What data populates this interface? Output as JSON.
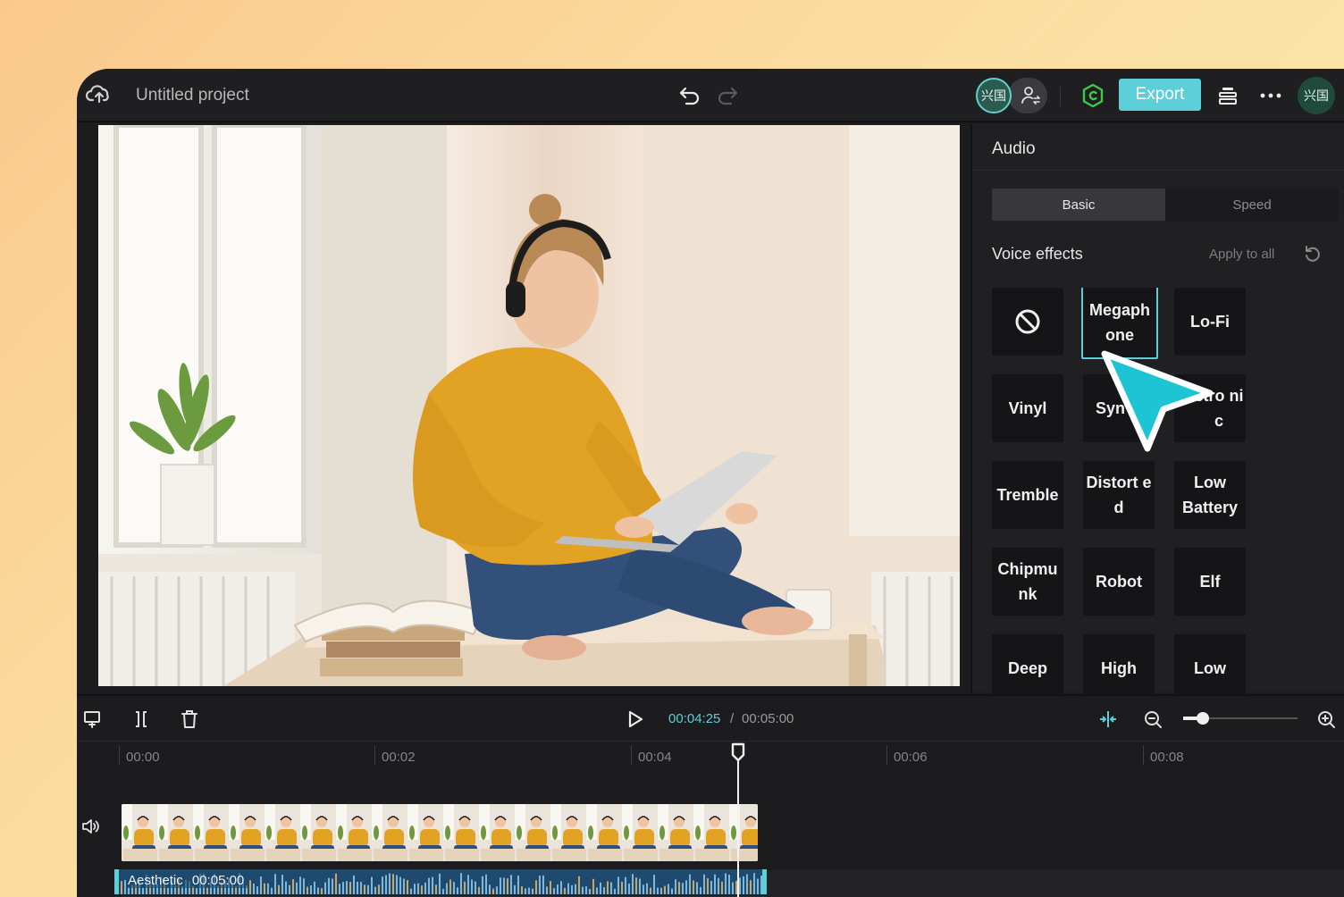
{
  "header": {
    "project_title": "Untitled project",
    "collaborator_initials": "兴国",
    "export_label": "Export",
    "user_initials": "兴国"
  },
  "panel": {
    "title": "Audio",
    "tabs": [
      {
        "label": "Basic",
        "active": true
      },
      {
        "label": "Speed",
        "active": false
      }
    ],
    "section_title": "Voice effects",
    "apply_all_label": "Apply to all",
    "effects": [
      {
        "label": "",
        "icon": "none-icon"
      },
      {
        "label": "Megaph one",
        "selected": true
      },
      {
        "label": "Lo-Fi"
      },
      {
        "label": "Vinyl"
      },
      {
        "label": "Syn"
      },
      {
        "label": "ctro nic"
      },
      {
        "label": "Tremble"
      },
      {
        "label": "Distort ed"
      },
      {
        "label": "Low Battery"
      },
      {
        "label": "Chipmu nk"
      },
      {
        "label": "Robot"
      },
      {
        "label": "Elf"
      },
      {
        "label": "Deep"
      },
      {
        "label": "High"
      },
      {
        "label": "Low"
      }
    ]
  },
  "timeline": {
    "current_time": "00:04:25",
    "separator": "/",
    "total_time": "00:05:00",
    "zoom_level": 0.15,
    "ruler": [
      "00:00",
      "00:02",
      "00:04",
      "00:06",
      "00:08"
    ],
    "audio_clip_name": "Aesthetic",
    "audio_clip_duration": "00:05:00"
  },
  "colors": {
    "accent": "#5ccfd8",
    "panel_bg": "#202023",
    "app_bg": "#1c1c1f",
    "brand_green": "#3ec94a"
  }
}
